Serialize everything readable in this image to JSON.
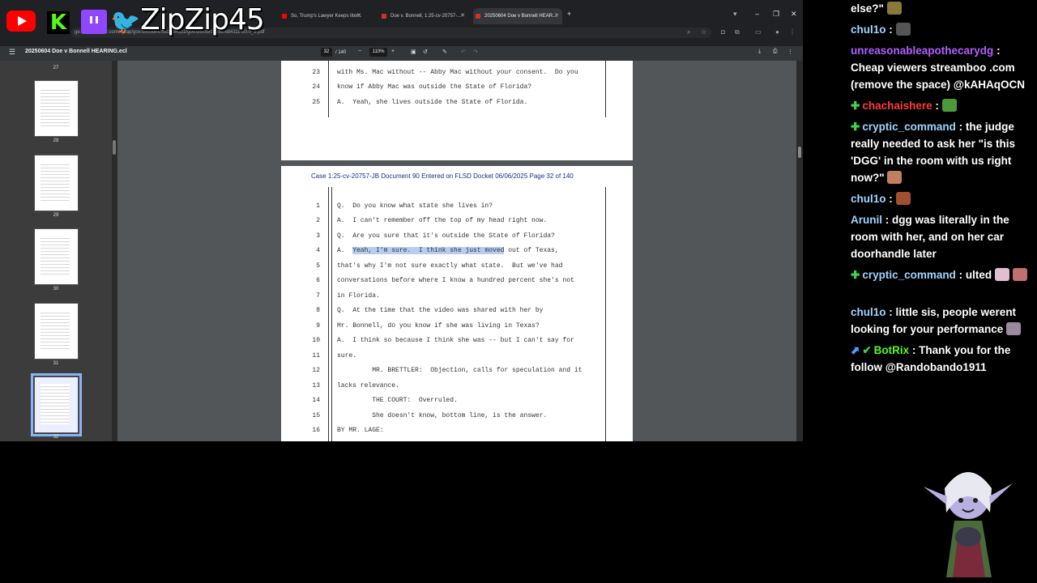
{
  "overlay": {
    "streamer_name": "ZipZip45"
  },
  "browser": {
    "tabs": [
      {
        "label": "So, Trump's Lawyer Keeps liter...",
        "color": "#ff0000"
      },
      {
        "label": "Doe v. Bonnell, 1:25-cv-20757-...",
        "color": "#d93025"
      },
      {
        "label": "20250604 Doe v Bonnell HEAR...",
        "color": "#d93025"
      }
    ],
    "address": "ge.courtlistener.com/recap/gov.uscourts.flsd.684111/gov.uscourts.flsd.684111.90.0_3.pdf"
  },
  "pdf": {
    "title": "20250604 Doe v Bonnell HEARING.ecl",
    "page_current": "32",
    "page_total": "/ 140",
    "zoom": "110%",
    "thumbnails": [
      {
        "num": "27"
      },
      {
        "num": "28"
      },
      {
        "num": "29"
      },
      {
        "num": "30"
      },
      {
        "num": "31"
      },
      {
        "num": "32"
      }
    ],
    "prev_page_lines": [
      {
        "n": "23",
        "t": "with Ms. Mac without -- Abby Mac without your consent.  Do you"
      },
      {
        "n": "24",
        "t": "know if Abby Mac was outside the State of Florida?"
      },
      {
        "n": "25",
        "t": "A.  Yeah, she lives outside the State of Florida."
      }
    ],
    "case_header": "Case 1:25-cv-20757-JB   Document 90   Entered on FLSD Docket 06/06/2025   Page 32 of 140",
    "lines": [
      {
        "n": "1",
        "t": "Q.  Do you know what state she lives in?"
      },
      {
        "n": "2",
        "t": "A.  I can't remember off the top of my head right now."
      },
      {
        "n": "3",
        "t": "Q.  Are you sure that it's outside the State of Florida?"
      },
      {
        "n": "4",
        "pre": "A.  ",
        "hl": "Yeah, I'm sure.  I think she just moved",
        "post": " out of Texas,"
      },
      {
        "n": "5",
        "t": "that's why I'm not sure exactly what state.  But we've had"
      },
      {
        "n": "6",
        "t": "conversations before where I know a hundred percent she's not"
      },
      {
        "n": "7",
        "t": "in Florida."
      },
      {
        "n": "8",
        "t": "Q.  At the time that the video was shared with her by"
      },
      {
        "n": "9",
        "t": "Mr. Bonnell, do you know if she was living in Texas?"
      },
      {
        "n": "10",
        "t": "A.  I think so because I think she was -- but I can't say for"
      },
      {
        "n": "11",
        "t": "sure."
      },
      {
        "n": "12",
        "t": "         MR. BRETTLER:  Objection, calls for speculation and it"
      },
      {
        "n": "13",
        "t": "lacks relevance."
      },
      {
        "n": "14",
        "t": "         THE COURT:  Overruled."
      },
      {
        "n": "15",
        "t": "         She doesn't know, bottom line, is the answer."
      },
      {
        "n": "16",
        "t": "BY MR. LAGE:"
      }
    ]
  },
  "chat": [
    {
      "text": "else?\"",
      "emote": "#8a7a3a"
    },
    {
      "user": "chul1o",
      "user_color": "#9fd3ff",
      "text": "",
      "emote": "#555"
    },
    {
      "user": "unreasonableapothecarydg",
      "user_color": "#b060ff",
      "text": "Cheap viewers streamboo .com (remove the space) @kAHAqOCN"
    },
    {
      "user": "chachaishere",
      "user_color": "#ff3a3a",
      "badge": true,
      "text": "",
      "emote": "#4a9a3a"
    },
    {
      "user": "cryptic_command",
      "user_color": "#9fd3ff",
      "badge": true,
      "text": "the judge really needed to ask her \"is this 'DGG' in the room with us right now?\"",
      "emote": "#c08060"
    },
    {
      "user": "chul1o",
      "user_color": "#9fd3ff",
      "text": "",
      "emote": "#a05030"
    },
    {
      "user": "Arunil",
      "user_color": "#9fd3ff",
      "text": "dgg was literally in the room with her, and on her car doorhandle later"
    },
    {
      "user": "cryptic_command",
      "user_color": "#9fd3ff",
      "badge": true,
      "text": "ulted",
      "emote": "#e0c0d0"
    },
    {
      "user": "chul1o",
      "user_color": "#9fd3ff",
      "text": "little sis, people werent looking for your performance",
      "emote": "#9a8aa0"
    },
    {
      "user": "BotRix",
      "user_color": "#53fc18",
      "text": "Thank you for the follow @Randobando1911"
    }
  ]
}
